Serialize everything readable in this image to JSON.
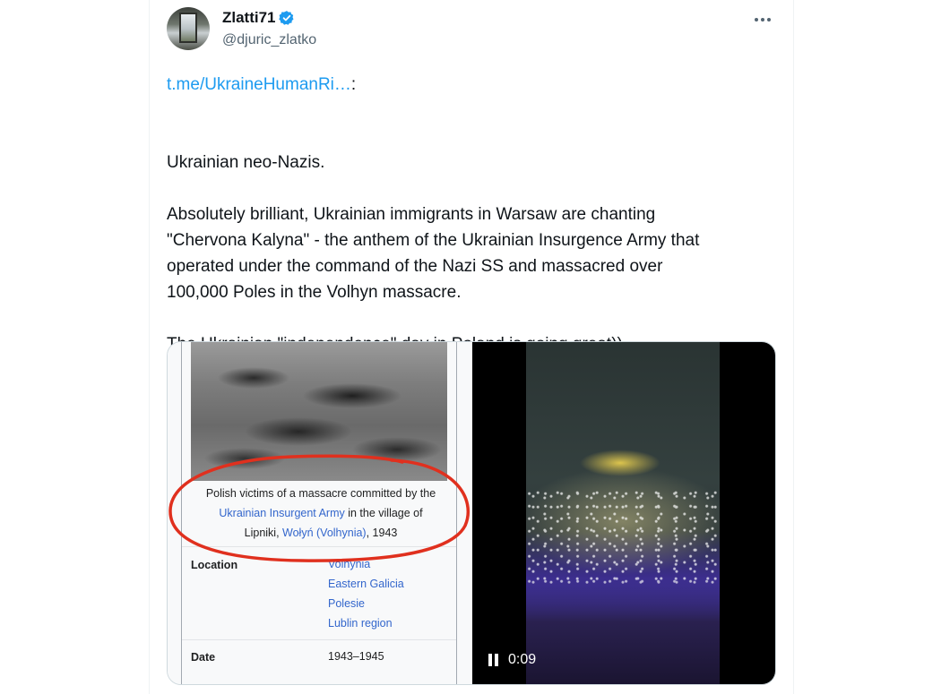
{
  "author": {
    "display_name": "Zlatti71",
    "handle": "@djuric_zlatko",
    "verified": true,
    "icon": "verified-badge-icon"
  },
  "menu": {
    "icon": "more-options-icon"
  },
  "tweet": {
    "link_text": "t.me/UkraineHumanRi…",
    "link_suffix": ":",
    "flag_line": "Ukrainian neo-Nazis.",
    "paragraph_1_line_1": "Absolutely brilliant, Ukrainian immigrants in Warsaw are chanting",
    "paragraph_1_line_2": "\"Chervona Kalyna\" - the anthem of the Ukrainian Insurgence Army that",
    "paragraph_1_line_3": "operated under the command of the Nazi SS and massacred over",
    "paragraph_1_line_4": "100,000 Poles in the Volhyn massacre.",
    "paragraph_2": "The Ukrainian \"independence\" day in Poland is going great))"
  },
  "media": {
    "image": {
      "caption_line_1": "Polish victims of a massacre committed by the",
      "caption_link_1": "Ukrainian Insurgent Army",
      "caption_line_2_rest": " in the village of",
      "caption_line_3_start": "Lipniki, ",
      "caption_link_2": "Wołyń (Volhynia)",
      "caption_line_3_end": ", 1943",
      "location_label": "Location",
      "locations": [
        "Volhynia",
        "Eastern Galicia",
        "Polesie",
        "Lublin region"
      ],
      "date_label": "Date",
      "date_value": "1943–1945"
    },
    "video": {
      "time": "0:09"
    }
  },
  "colors": {
    "link": "#1d9bf0",
    "wiki_link": "#3366cc",
    "verified": "#1d9bf0",
    "annotation_red": "#e0301e"
  }
}
